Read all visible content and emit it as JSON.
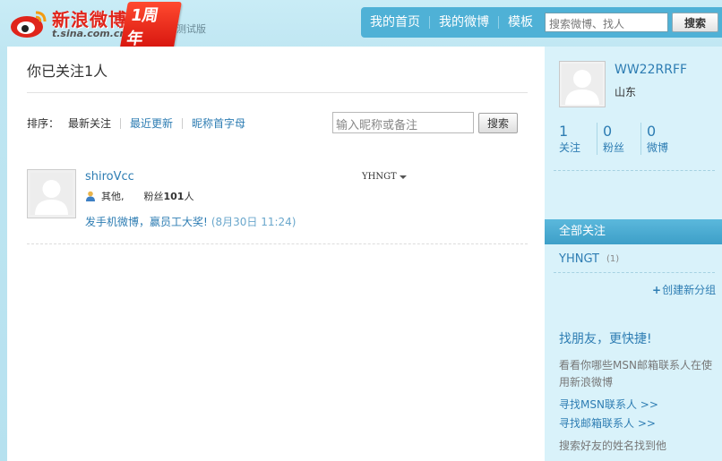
{
  "header": {
    "logo_name": "新浪微博",
    "logo_domain": "t.sina.com.cn",
    "anniversary": "1周年",
    "beta": "测试版",
    "nav": [
      "我的首页",
      "我的微博",
      "模板"
    ],
    "search_placeholder": "搜索微博、找人",
    "search_button": "搜索"
  },
  "main": {
    "title": "你已关注1人",
    "sort_label": "排序：",
    "sort_options": [
      "最新关注",
      "最近更新",
      "昵称首字母"
    ],
    "nick_placeholder": "输入昵称或备注",
    "nick_search_button": "搜索",
    "follows": [
      {
        "name": "shiroVcc",
        "location": "其他,",
        "fans_label": "粉丝",
        "fans_count": "101",
        "fans_unit": "人",
        "latest": "发手机微博，赢员工大奖!",
        "time": "(8月30日 11:24)",
        "group": "YHNGT"
      }
    ]
  },
  "sidebar": {
    "username": "WW22RRFF",
    "location": "山东",
    "stats": [
      {
        "num": "1",
        "label": "关注"
      },
      {
        "num": "0",
        "label": "粉丝"
      },
      {
        "num": "0",
        "label": "微博"
      }
    ],
    "all_follows": "全部关注",
    "groups": [
      {
        "name": "YHNGT",
        "count": "(1)"
      }
    ],
    "create_group": "创建新分组",
    "find_title": "找朋友，更快捷!",
    "find_desc": "看看你哪些MSN邮箱联系人在使用新浪微博",
    "find_msn": "寻找MSN联系人 >>",
    "find_mail": "寻找邮箱联系人 >>",
    "search_friend": "搜索好友的姓名找到他"
  },
  "colors": {
    "link": "#2e7db3",
    "nav_bg": "#4fb1d6",
    "brand_red": "#e0251b"
  }
}
